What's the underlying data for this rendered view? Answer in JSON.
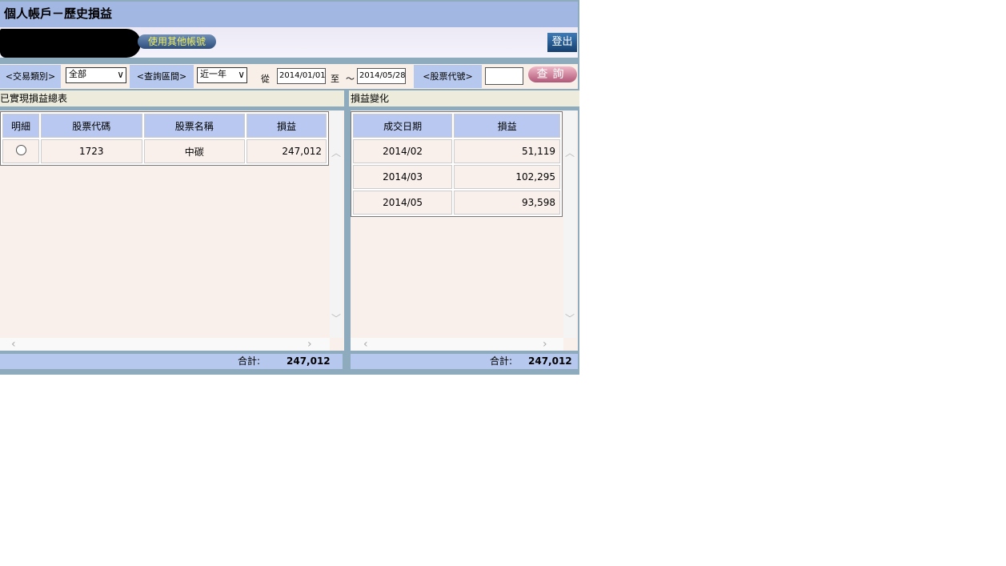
{
  "title": "個人帳戶－歷史損益",
  "other_account": "使用其他帳號",
  "logout": "登出",
  "filters": {
    "trade_type_label": "<交易類別>",
    "trade_type_value": "全部",
    "period_label": "<查詢區間>",
    "period_value": "近一年",
    "from_label": "從",
    "from_date": "2014/01/01",
    "to_label": "至",
    "tilde": "～",
    "to_date": "2014/05/28",
    "stock_label": "<股票代號>",
    "stock_value": "",
    "query": "查詢"
  },
  "left": {
    "title": "已實現損益總表",
    "headers": [
      "明細",
      "股票代碼",
      "股票名稱",
      "損益"
    ],
    "rows": [
      {
        "code": "1723",
        "name": "中碳",
        "pl": "247,012"
      }
    ],
    "total_label": "合計:",
    "total": "247,012"
  },
  "right": {
    "title": "損益變化",
    "headers": [
      "成交日期",
      "損益"
    ],
    "rows": [
      {
        "date": "2014/02",
        "pl": "51,119"
      },
      {
        "date": "2014/03",
        "pl": "102,295"
      },
      {
        "date": "2014/05",
        "pl": "93,598"
      }
    ],
    "total_label": "合計:",
    "total": "247,012"
  }
}
